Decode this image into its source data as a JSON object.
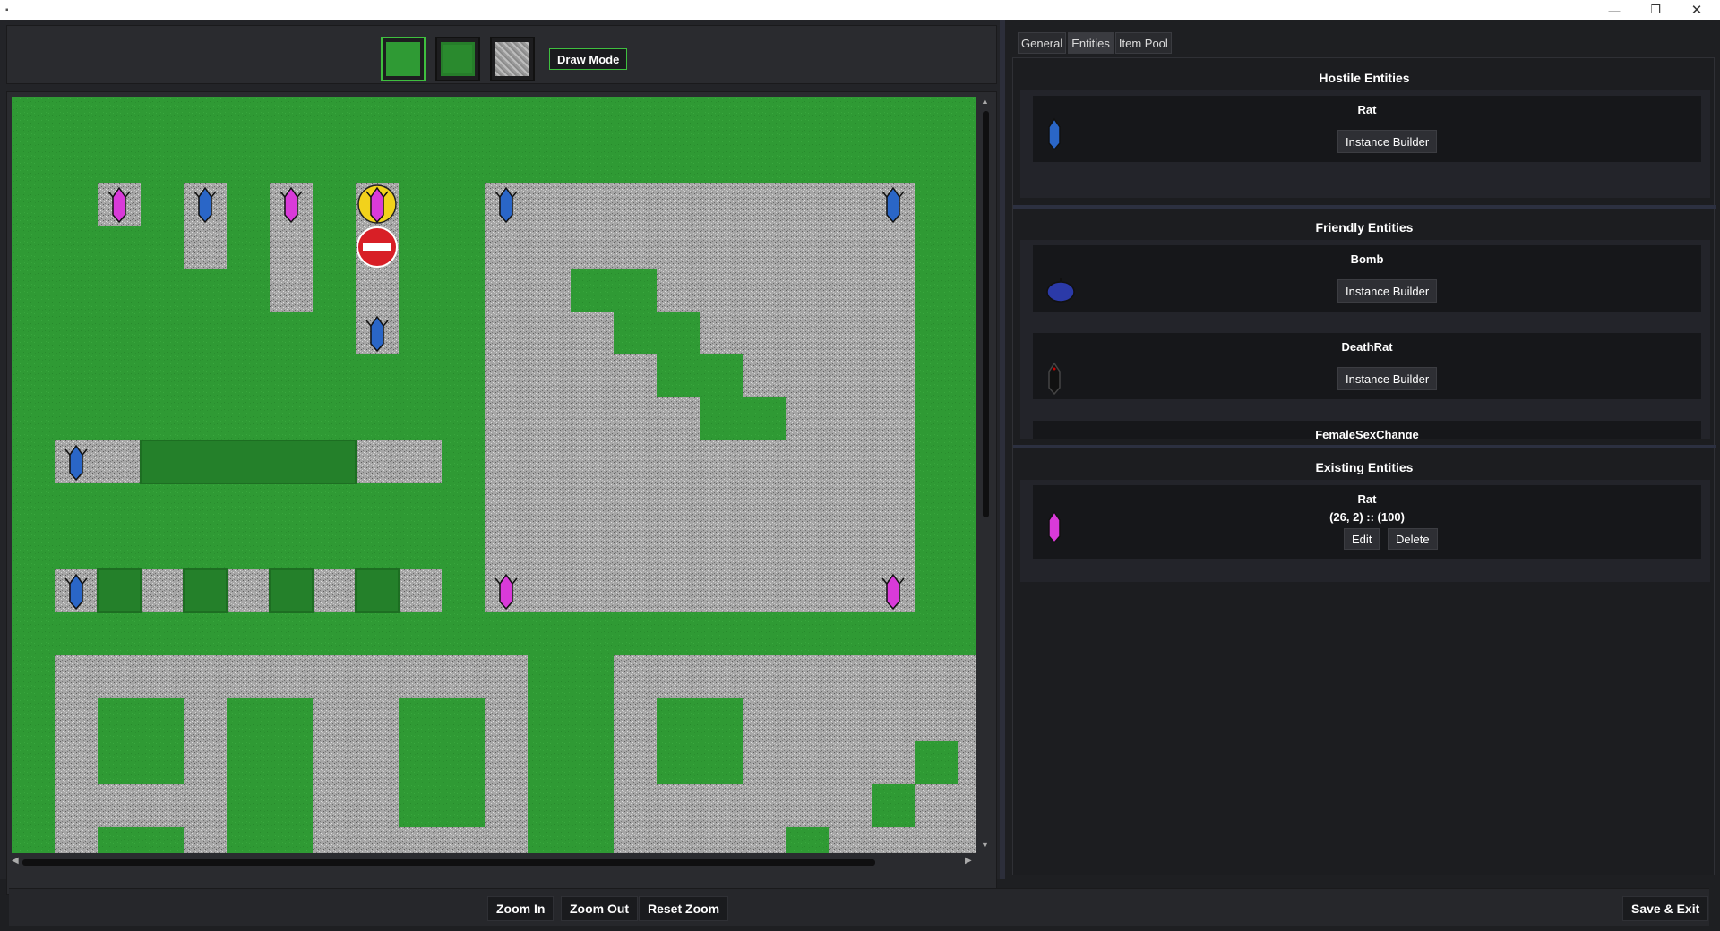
{
  "window": {
    "minimize_glyph": "—",
    "maximize_glyph": "❐",
    "close_glyph": "✕"
  },
  "toolbar": {
    "tiles": [
      {
        "name": "grass-tile",
        "selected": true
      },
      {
        "name": "hedge-tile",
        "selected": false
      },
      {
        "name": "stone-tile",
        "selected": false
      }
    ],
    "draw_mode_label": "Draw Mode"
  },
  "tabs": [
    {
      "label": "General",
      "active": false
    },
    {
      "label": "Entities",
      "active": true
    },
    {
      "label": "Item Pool",
      "active": false
    }
  ],
  "hostile": {
    "title": "Hostile Entities",
    "items": [
      {
        "name": "Rat",
        "button": "Instance Builder",
        "icon": "rat-blue-icon"
      }
    ]
  },
  "friendly": {
    "title": "Friendly Entities",
    "items": [
      {
        "name": "Bomb",
        "button": "Instance Builder",
        "icon": "bomb-icon"
      },
      {
        "name": "DeathRat",
        "button": "Instance Builder",
        "icon": "deathrat-icon"
      },
      {
        "name": "FemaleSexChange",
        "button": "",
        "icon": "potion-icon"
      }
    ]
  },
  "existing": {
    "title": "Existing Entities",
    "items": [
      {
        "name": "Rat",
        "coords": "(26, 2) :: (100)",
        "edit_label": "Edit",
        "delete_label": "Delete",
        "icon": "rat-magenta-icon"
      }
    ]
  },
  "bottom": {
    "zoom_in": "Zoom In",
    "zoom_out": "Zoom Out",
    "reset_zoom": "Reset Zoom",
    "save_exit": "Save & Exit"
  },
  "colors": {
    "grass": "#2f9a34",
    "stone": "#a9a9a9",
    "rat_blue": "#2a66c7",
    "rat_magenta": "#d93ad9",
    "accent_green": "#3fbf3f"
  }
}
